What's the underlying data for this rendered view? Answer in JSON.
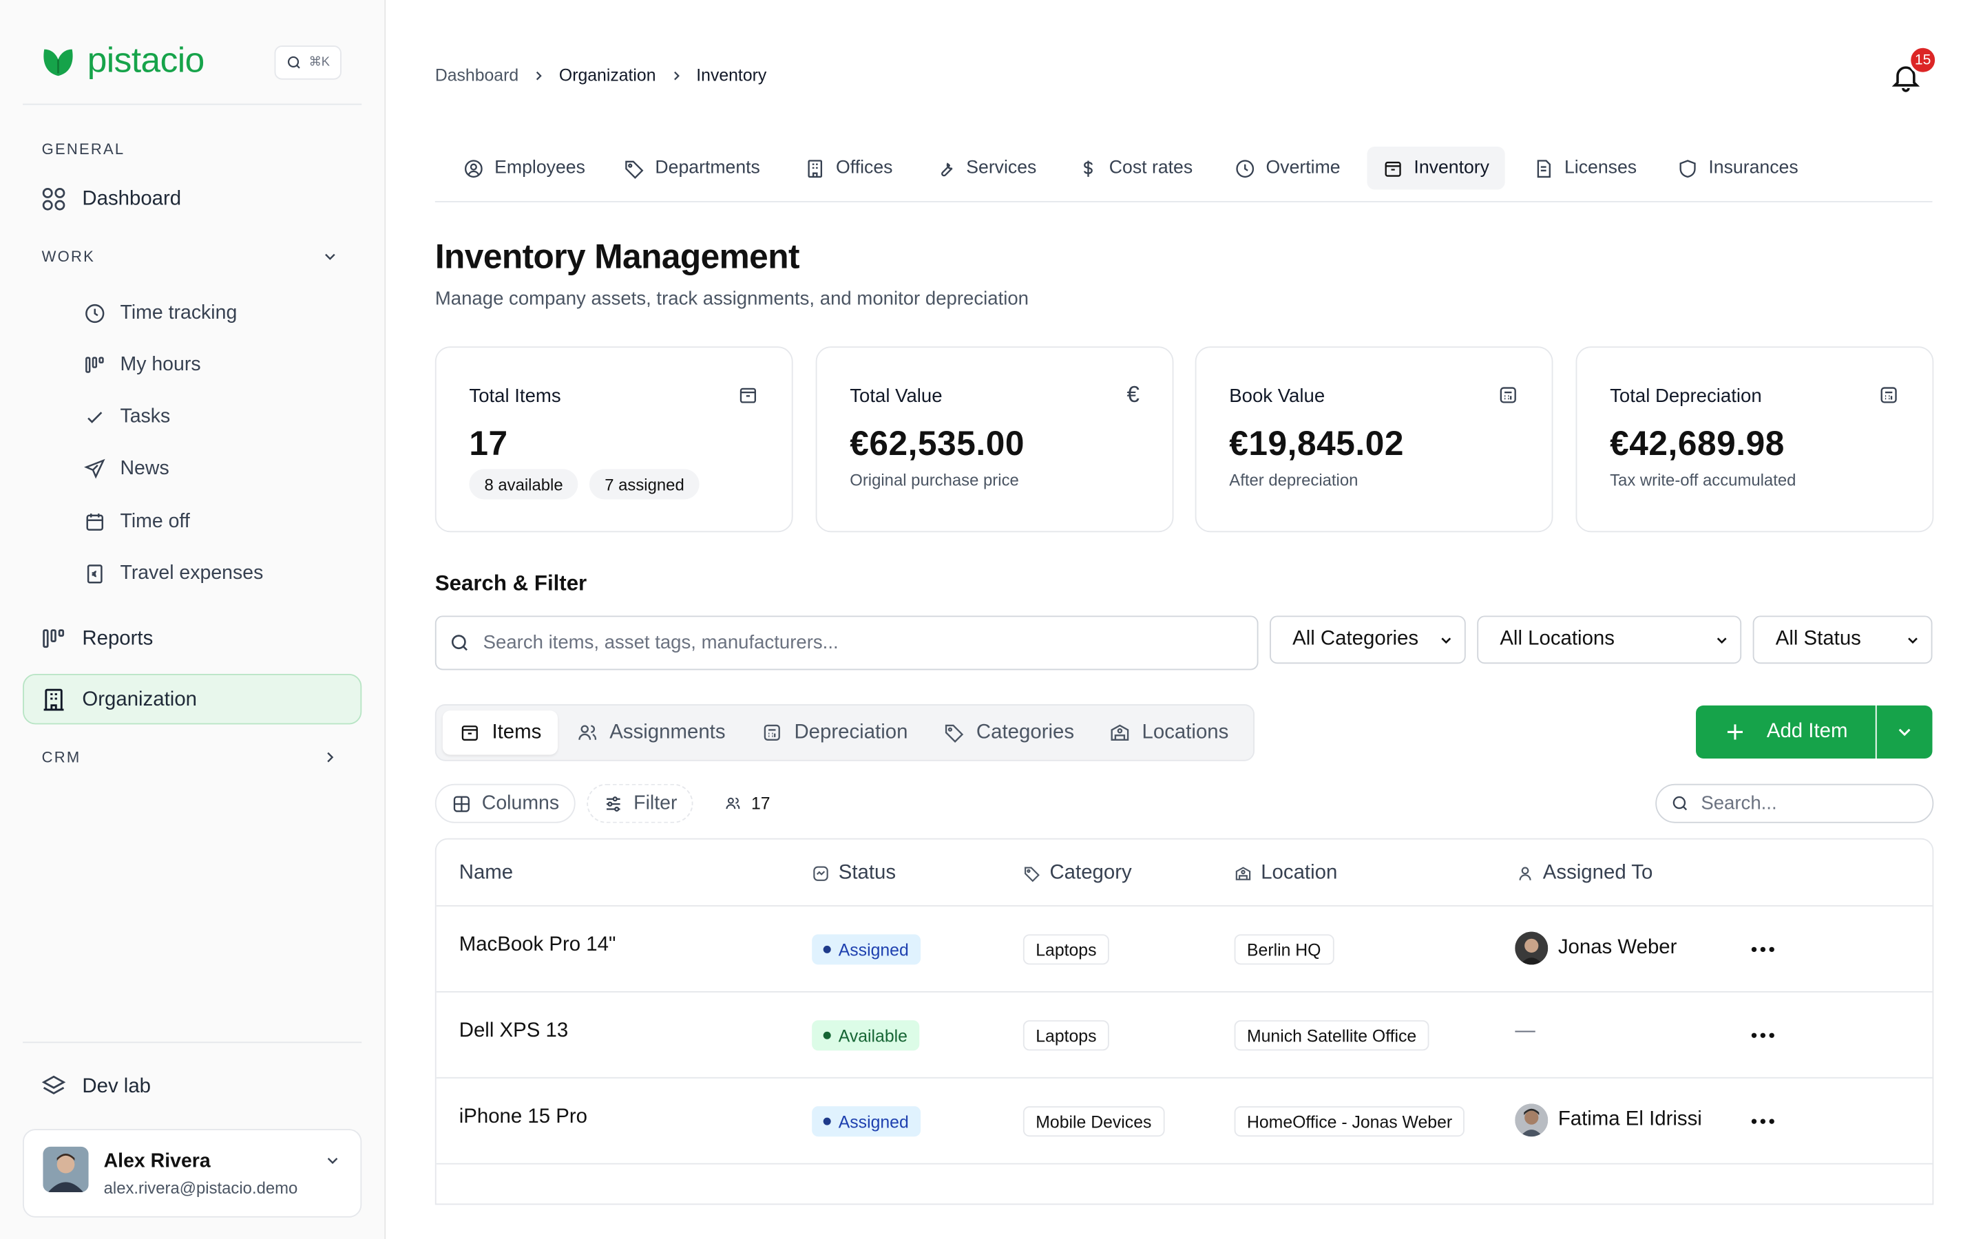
{
  "app": {
    "name": "pistacio",
    "shortcut": "⌘K"
  },
  "sidebar": {
    "general_label": "GENERAL",
    "dashboard": "Dashboard",
    "work_label": "WORK",
    "work_items": [
      {
        "label": "Time tracking",
        "icon": "clock-icon"
      },
      {
        "label": "My hours",
        "icon": "bars-icon"
      },
      {
        "label": "Tasks",
        "icon": "check-icon"
      },
      {
        "label": "News",
        "icon": "send-icon"
      },
      {
        "label": "Time off",
        "icon": "calendar-icon"
      },
      {
        "label": "Travel expenses",
        "icon": "receipt-icon"
      }
    ],
    "reports": "Reports",
    "organization": "Organization",
    "crm_label": "CRM",
    "devlab": "Dev lab",
    "user": {
      "name": "Alex Rivera",
      "email": "alex.rivera@pistacio.demo"
    }
  },
  "breadcrumb": [
    "Dashboard",
    "Organization",
    "Inventory"
  ],
  "notifications": {
    "count": "15"
  },
  "tabs": [
    "Employees",
    "Departments",
    "Offices",
    "Services",
    "Cost rates",
    "Overtime",
    "Inventory",
    "Licenses",
    "Insurances"
  ],
  "page": {
    "title": "Inventory Management",
    "subtitle": "Manage company assets, track assignments, and monitor depreciation"
  },
  "cards": [
    {
      "label": "Total Items",
      "value": "17",
      "chips": [
        "8 available",
        "7 assigned"
      ]
    },
    {
      "label": "Total Value",
      "value": "€62,535.00",
      "note": "Original purchase price",
      "icon": "€"
    },
    {
      "label": "Book Value",
      "value": "€19,845.02",
      "note": "After depreciation"
    },
    {
      "label": "Total Depreciation",
      "value": "€42,689.98",
      "note": "Tax write-off accumulated"
    }
  ],
  "filter": {
    "title": "Search & Filter",
    "search_placeholder": "Search items, asset tags, manufacturers...",
    "categories": "All Categories",
    "locations": "All Locations",
    "status": "All Status"
  },
  "view_tabs": [
    "Items",
    "Assignments",
    "Depreciation",
    "Categories",
    "Locations"
  ],
  "actions": {
    "add_item": "Add Item"
  },
  "toolbar": {
    "columns": "Columns",
    "filter": "Filter",
    "count": "17",
    "search_placeholder": "Search..."
  },
  "table": {
    "headers": [
      "Name",
      "Status",
      "Category",
      "Location",
      "Assigned To"
    ],
    "rows": [
      {
        "name": "MacBook Pro 14\"",
        "status": "Assigned",
        "category": "Laptops",
        "location": "Berlin HQ",
        "assigned": "Jonas Weber"
      },
      {
        "name": "Dell XPS 13",
        "status": "Available",
        "category": "Laptops",
        "location": "Munich Satellite Office",
        "assigned": "—"
      },
      {
        "name": "iPhone 15 Pro",
        "status": "Assigned",
        "category": "Mobile Devices",
        "location": "HomeOffice - Jonas Weber",
        "assigned": "Fatima El Idrissi"
      }
    ]
  },
  "colors": {
    "brand": "#16a34a",
    "assigned_bg": "#e0f2fe",
    "assigned_text": "#1e40af",
    "available_bg": "#dcfce7",
    "available_text": "#166534",
    "badge": "#dc2626"
  }
}
